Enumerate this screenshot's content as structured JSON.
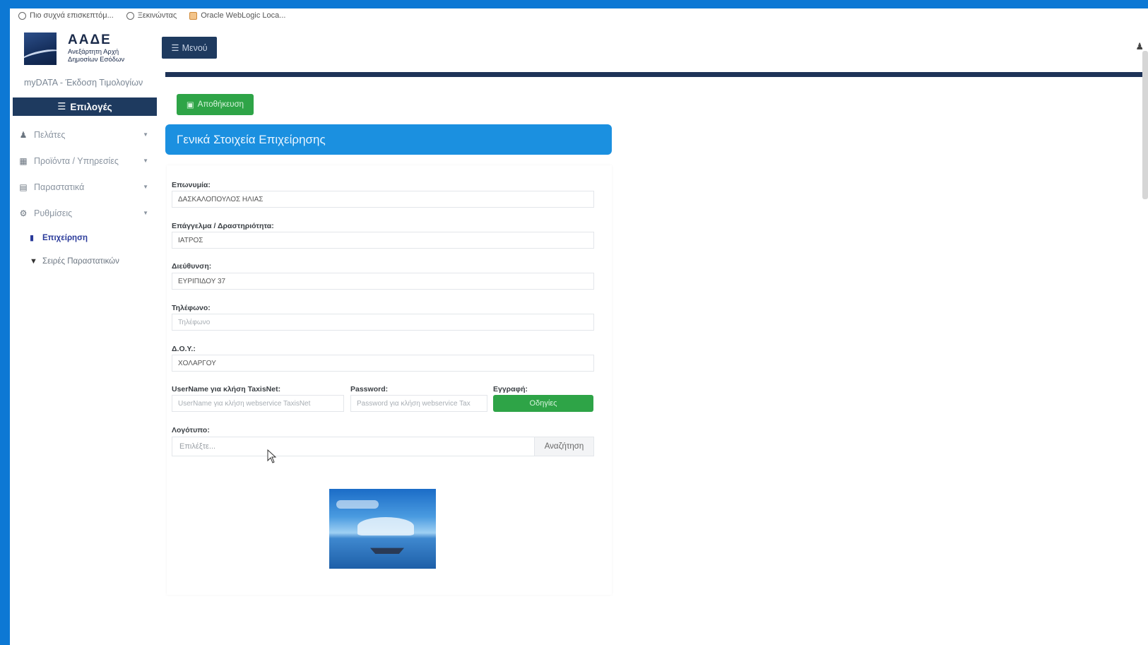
{
  "bookmarks": [
    {
      "label": "Πιο συχνά επισκεπτόμ...",
      "icon": "gear-icon"
    },
    {
      "label": "Ξεκινώντας",
      "icon": "globe-icon"
    },
    {
      "label": "Oracle WebLogic Loca...",
      "icon": "folder-icon"
    }
  ],
  "brand": {
    "abbr": "ΑΑΔΕ",
    "subtitle": "Ανεξάρτητη Αρχή Δημοσίων Εσόδων",
    "app_title": "myDATA - Έκδοση Τιμολογίων"
  },
  "sidebar": {
    "options_label": "Επιλογές",
    "items": [
      {
        "label": "Πελάτες",
        "icon": "user-icon"
      },
      {
        "label": "Προϊόντα / Υπηρεσίες",
        "icon": "grid-icon"
      },
      {
        "label": "Παραστατικά",
        "icon": "documents-icon"
      },
      {
        "label": "Ρυθμίσεις",
        "icon": "gear-icon"
      }
    ],
    "subitems": [
      {
        "label": "Επιχείρηση",
        "icon": "building-icon",
        "active": true
      },
      {
        "label": "Σειρές Παραστατικών",
        "icon": "filter-icon",
        "active": false
      }
    ]
  },
  "header": {
    "menu_label": "Μενού"
  },
  "toolbar": {
    "save_label": "Αποθήκευση"
  },
  "section": {
    "title": "Γενικά Στοιχεία Επιχείρησης"
  },
  "form": {
    "company_label": "Επωνυμία:",
    "company_value": "ΔΑΣΚΑΛΟΠΟΥΛΟΣ ΗΛΙΑΣ",
    "profession_label": "Επάγγελμα / Δραστηριότητα:",
    "profession_value": "ΙΑΤΡΟΣ",
    "address_label": "Διεύθυνση:",
    "address_value": "ΕΥΡΙΠΙΔΟΥ 37",
    "phone_label": "Τηλέφωνο:",
    "phone_placeholder": "Τηλέφωνο",
    "tax_office_label": "Δ.Ο.Υ.:",
    "tax_office_value": "ΧΟΛΑΡΓΟΥ",
    "username_label": "UserName για κλήση TaxisNet:",
    "username_placeholder": "UserName για κλήση webservice TaxisNet",
    "password_label": "Password:",
    "password_placeholder": "Password για κλήση webservice Tax",
    "registration_label": "Εγγραφή:",
    "guide_button": "Οδηγίες",
    "logo_label": "Λογότυπο:",
    "logo_placeholder": "Επιλέξτε...",
    "search_button": "Αναζήτηση"
  },
  "colors": {
    "navy": "#1e3a5f",
    "green": "#2ea447",
    "blue_header": "#1b90e0",
    "frame": "#0d78d4"
  }
}
